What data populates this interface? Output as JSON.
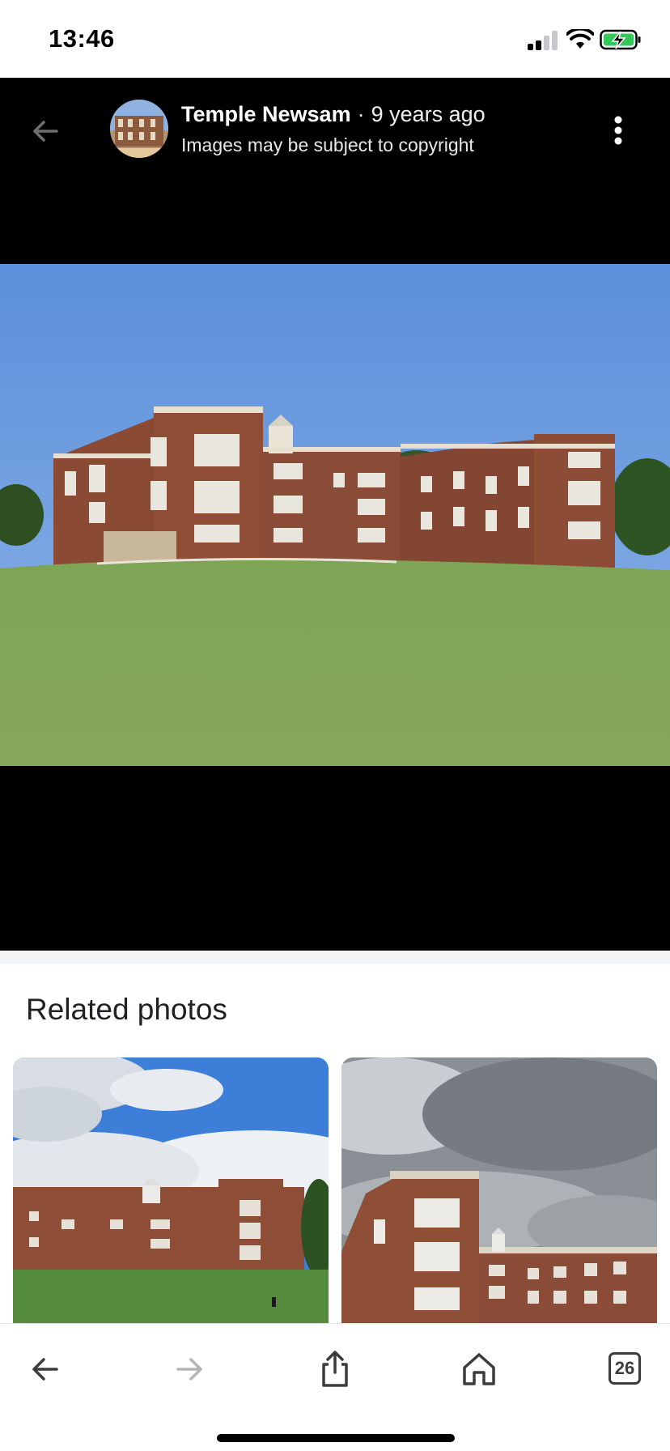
{
  "status_bar": {
    "time": "13:46",
    "icons": [
      "cellular-signal-icon",
      "wifi-icon",
      "battery-charging-icon"
    ]
  },
  "viewer": {
    "source_name": "Temple Newsam",
    "separator": "·",
    "age": "9 years ago",
    "notice": "Images may be subject to copyright",
    "icons": [
      "back-arrow-icon",
      "more-vertical-icon"
    ]
  },
  "related": {
    "title": "Related photos",
    "cards": [
      {
        "alt": "Temple Newsam under cloudy blue sky"
      },
      {
        "alt": "Temple Newsam under grey clouds"
      }
    ]
  },
  "toolbar": {
    "tab_count": "26",
    "icons": [
      "back-icon",
      "forward-icon",
      "share-icon",
      "home-icon",
      "tabs-icon"
    ]
  },
  "colors": {
    "viewer_bg": "#000000",
    "sky": "#5b93dc",
    "grass": "#7a9c4c",
    "brick": "#8a4a32"
  }
}
